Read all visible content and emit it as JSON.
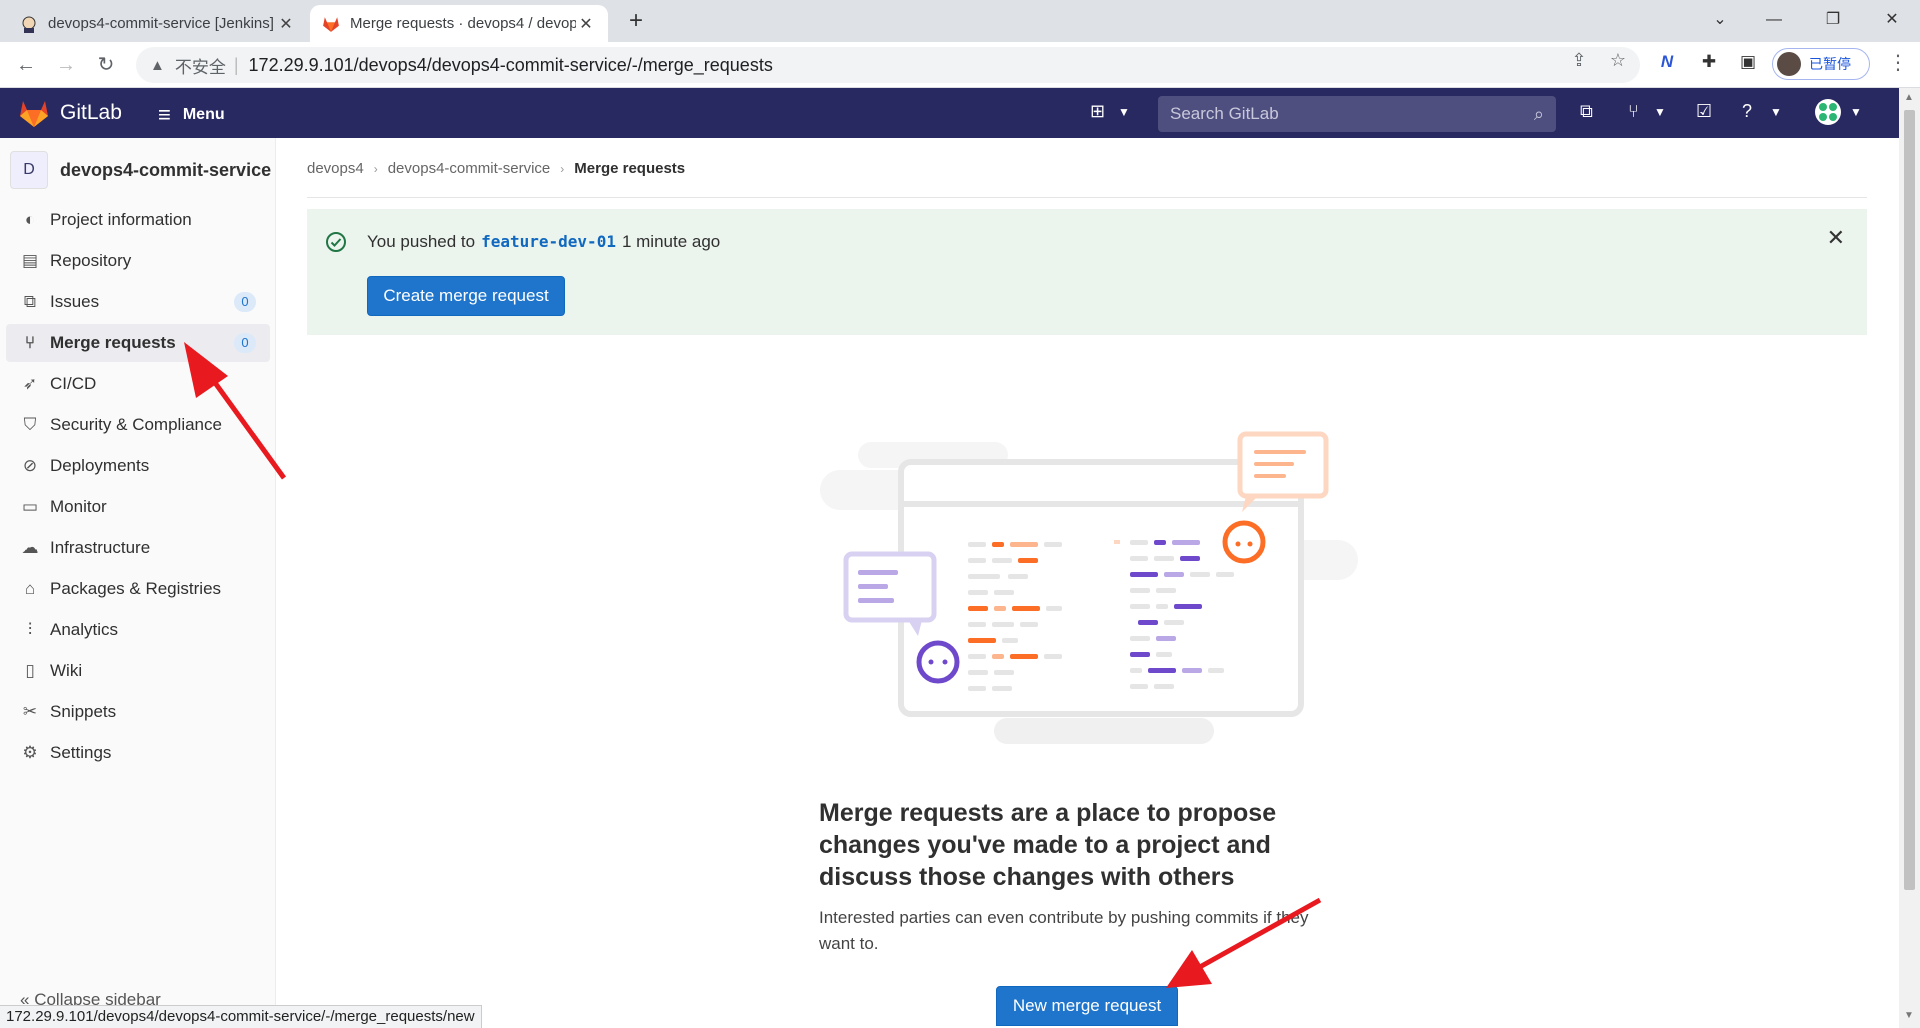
{
  "browser": {
    "tabs": [
      {
        "title": "devops4-commit-service [Jenkins]",
        "active": false
      },
      {
        "title": "Merge requests · devops4 / devops4-commit-service",
        "active": true
      }
    ],
    "new_tab_icon": "plus-icon",
    "omnibox": {
      "insecure_label": "不安全",
      "url": "172.29.9.101/devops4/devops4-commit-service/-/merge_requests"
    },
    "profile_label": "已暂停"
  },
  "header": {
    "brand": "GitLab",
    "menu_label": "Menu",
    "search_placeholder": "Search GitLab",
    "colors": {
      "header_bg": "#292961",
      "accent": "#1f75cb"
    }
  },
  "sidebar": {
    "project_avatar": "D",
    "project_name": "devops4-commit-service",
    "items": [
      {
        "label": "Project information",
        "icon": "project-icon"
      },
      {
        "label": "Repository",
        "icon": "doc-icon"
      },
      {
        "label": "Issues",
        "icon": "issues-icon",
        "badge": "0"
      },
      {
        "label": "Merge requests",
        "icon": "merge-request-icon",
        "badge": "0",
        "active": true
      },
      {
        "label": "CI/CD",
        "icon": "rocket-icon"
      },
      {
        "label": "Security & Compliance",
        "icon": "shield-icon"
      },
      {
        "label": "Deployments",
        "icon": "deployments-icon"
      },
      {
        "label": "Monitor",
        "icon": "monitor-icon"
      },
      {
        "label": "Infrastructure",
        "icon": "cloud-gear-icon"
      },
      {
        "label": "Packages & Registries",
        "icon": "package-icon"
      },
      {
        "label": "Analytics",
        "icon": "chart-icon"
      },
      {
        "label": "Wiki",
        "icon": "book-icon"
      },
      {
        "label": "Snippets",
        "icon": "scissors-icon"
      },
      {
        "label": "Settings",
        "icon": "gear-icon"
      }
    ],
    "collapse_label": "Collapse sidebar"
  },
  "breadcrumb": [
    "devops4",
    "devops4-commit-service",
    "Merge requests"
  ],
  "alert": {
    "prefix": "You pushed to",
    "branch": "feature-dev-01",
    "suffix": "1 minute ago",
    "button": "Create merge request"
  },
  "empty_state": {
    "title": "Merge requests are a place to propose changes you've made to a project and discuss those changes with others",
    "description": "Interested parties can even contribute by pushing commits if they want to.",
    "button": "New merge request"
  },
  "status_bar": "172.29.9.101/devops4/devops4-commit-service/-/merge_requests/new"
}
